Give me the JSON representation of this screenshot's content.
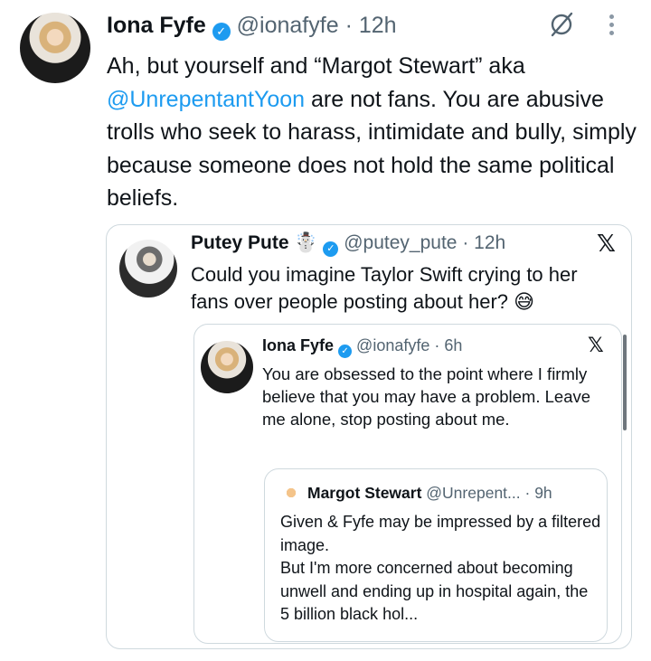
{
  "main_tweet": {
    "name": "Iona Fyfe",
    "handle": "@ionafyfe",
    "time": "· 12h",
    "text_before_mention": "Ah, but yourself and “Margot Stewart” aka ",
    "mention": "@UnrepentantYoon",
    "text_after_mention": " are not fans. You are abusive trolls who seek to harass, intimidate and bully, simply because someone does not hold the same political beliefs.",
    "more_icon": "⋮"
  },
  "quote_1": {
    "name": "Putey Pute",
    "emoji": "☃️",
    "handle": "@putey_pute",
    "time": "· 12h",
    "text": "Could you imagine Taylor Swift crying to her fans over people posting about her? 😅",
    "x_icon": "𝕏"
  },
  "quote_2": {
    "name": "Iona Fyfe",
    "handle": "@ionafyfe",
    "time": "· 6h",
    "text": "You are obsessed to the point where I firmly believe that you may have a problem. Leave me alone, stop posting about me.",
    "x_icon": "𝕏"
  },
  "quote_3": {
    "name": "Margot Stewart",
    "handle": "@Unrepent...",
    "time": "· 9h",
    "line1": "Given & Fyfe may be impressed by a filtered image.",
    "line2": "But I'm more concerned about becoming unwell and ending up in hospital again, the 5 billion black hol..."
  },
  "icons": {
    "verified": "✓",
    "grok": "grok-icon",
    "more": "more-icon",
    "x": "x-logo-icon"
  },
  "colors": {
    "link": "#1d9bf0",
    "verified": "#1d9bf0",
    "secondary_text": "#536471",
    "border": "#cfd9de"
  }
}
